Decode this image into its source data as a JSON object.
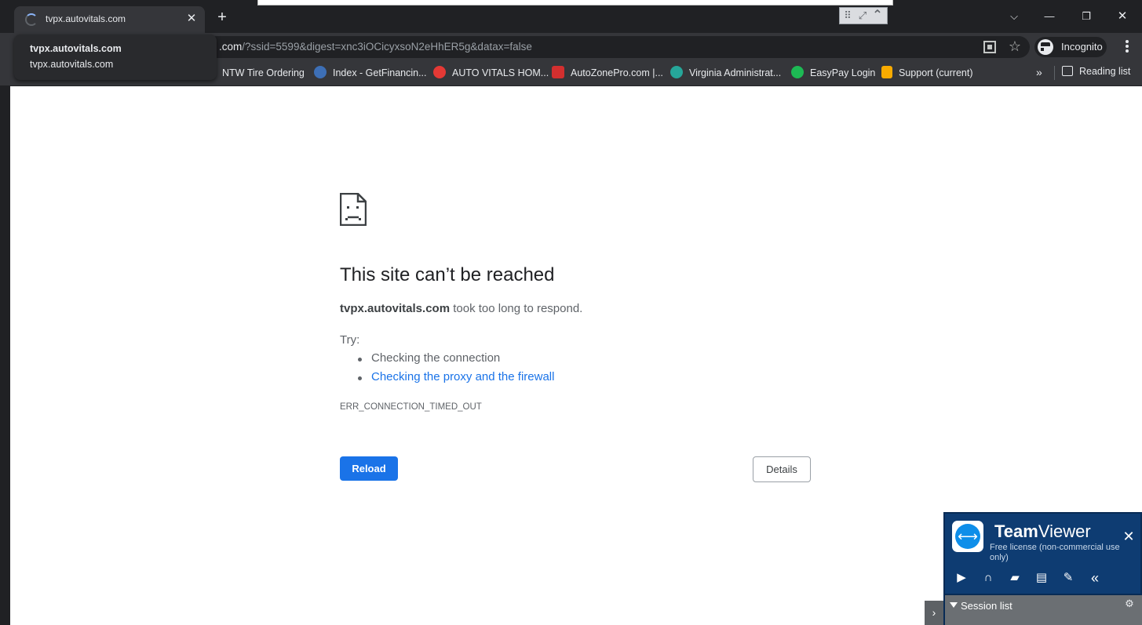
{
  "browser": {
    "tab": {
      "title": "tvpx.autovitals.com",
      "close_icon": "close-icon",
      "spinner_icon": "loading-spinner-icon"
    },
    "new_tab_label": "+",
    "tooltip": {
      "title": "tvpx.autovitals.com",
      "url": "tvpx.autovitals.com"
    },
    "address_bar": {
      "host_part": ".com",
      "rest": "/?ssid=5599&digest=xnc3iOCicyxsoN2eHhER5g&datax=false"
    },
    "incognito_label": "Incognito",
    "window_controls": {
      "tab_search": "⌵",
      "minimize": "—",
      "restore": "❐",
      "close": "✕"
    },
    "mini_toolbar": [
      "⠿",
      "⤢",
      "⌃"
    ],
    "bookmarks": [
      {
        "label": "NTW Tire Ordering",
        "icon": "ntw-favicon",
        "color": "#35363a"
      },
      {
        "label": "Index - GetFinancin...",
        "icon": "getfinancing-favicon",
        "color": "#3d6fb6"
      },
      {
        "label": "AUTO VITALS HOM...",
        "icon": "autovitals-favicon",
        "color": "#e53935"
      },
      {
        "label": "AutoZonePro.com |...",
        "icon": "autozone-favicon",
        "color": "#d32f2f"
      },
      {
        "label": "Virginia Administrat...",
        "icon": "virginia-favicon",
        "color": "#26a69a"
      },
      {
        "label": "EasyPay Login",
        "icon": "easypay-favicon",
        "color": "#1db954"
      },
      {
        "label": "Support (current)",
        "icon": "support-favicon",
        "color": "#f9ab00"
      }
    ],
    "bookmarks_more": "»",
    "reading_list": "Reading list"
  },
  "error_page": {
    "title": "This site can’t be reached",
    "host": "tvpx.autovitals.com",
    "message": " took too long to respond.",
    "try_label": "Try:",
    "suggestions": [
      "Checking the connection",
      "Checking the proxy and the firewall"
    ],
    "error_code": "ERR_CONNECTION_TIMED_OUT",
    "reload_label": "Reload",
    "details_label": "Details"
  },
  "teamviewer": {
    "brand_bold": "Team",
    "brand_light": "Viewer",
    "license": "Free license (non-commercial use only)",
    "close": "✕",
    "tools": [
      "video-icon",
      "headset-icon",
      "chat-icon",
      "files-icon",
      "remote-tools-icon",
      "collapse-icon"
    ],
    "session_list_label": "Session list",
    "expander": "›"
  },
  "colors": {
    "chrome_dark": "#202124",
    "chrome_toolbar": "#35363a",
    "link_blue": "#1a73e8",
    "teamviewer_blue": "#0e3c72"
  }
}
